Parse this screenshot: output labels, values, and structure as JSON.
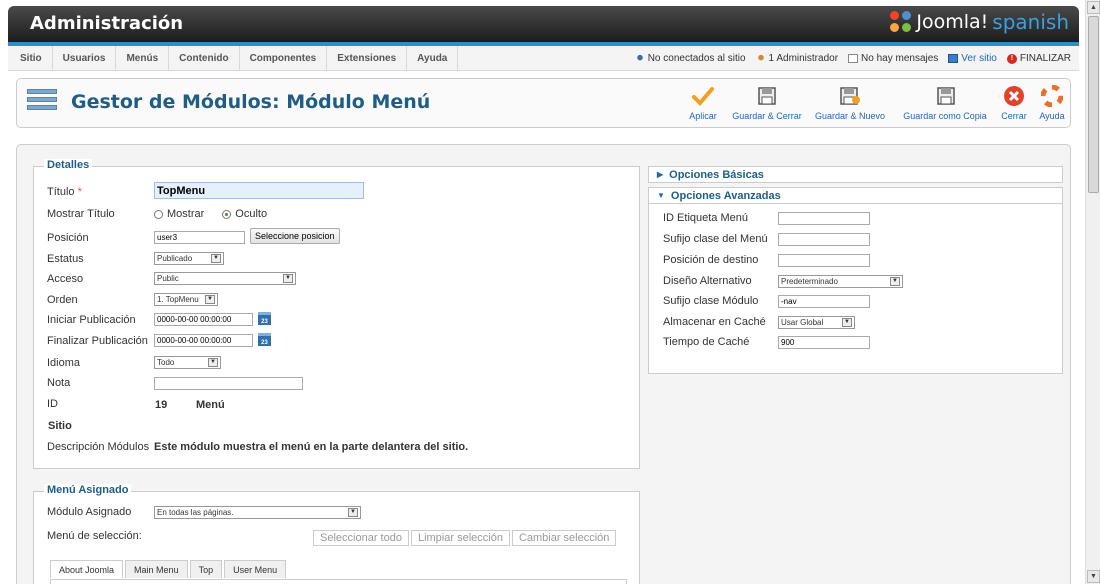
{
  "header": {
    "title": "Administración",
    "logo_main": "Joomla!",
    "logo_sub": "spanish"
  },
  "menu": [
    "Sitio",
    "Usuarios",
    "Menús",
    "Contenido",
    "Componentes",
    "Extensiones",
    "Ayuda"
  ],
  "status": {
    "visitors": "No conectados al sitio",
    "admins": "1 Administrador",
    "messages": "No hay mensajes",
    "view_site": "Ver sitio",
    "logout": "FINALIZAR"
  },
  "toolbar": {
    "page_title": "Gestor de Módulos: Módulo Menú",
    "buttons": [
      "Aplicar",
      "Guardar & Cerrar",
      "Guardar & Nuevo",
      "Guardar como Copia",
      "Cerrar",
      "Ayuda"
    ]
  },
  "details": {
    "legend": "Detalles",
    "titulo_label": "Título",
    "titulo_req": "*",
    "titulo_value": "TopMenu",
    "mostrar_label": "Mostrar Título",
    "mostrar_opt1": "Mostrar",
    "mostrar_opt2": "Oculto",
    "posicion_label": "Posición",
    "posicion_value": "user3",
    "posicion_button": "Seleccione posicion",
    "estatus_label": "Estatus",
    "estatus_value": "Publicado",
    "acceso_label": "Acceso",
    "acceso_value": "Public",
    "orden_label": "Orden",
    "orden_value": "1. TopMenu",
    "iniciar_label": "Iniciar Publicación",
    "iniciar_value": "0000-00-00 00:00:00",
    "finalizar_label": "Finalizar Publicación",
    "finalizar_value": "0000-00-00 00:00:00",
    "idioma_label": "Idioma",
    "idioma_value": "Todo",
    "nota_label": "Nota",
    "nota_value": "",
    "id_label": "ID",
    "id_value": "19",
    "id_type": "Menú",
    "sitio": "Sitio",
    "desc_label": "Descripción Módulos",
    "desc_value": "Este módulo muestra el menú en la parte delantera del sitio.",
    "cal_text": "23"
  },
  "options": {
    "basic": "Opciones Básicas",
    "advanced": "Opciones Avanzadas",
    "fields": [
      {
        "label": "ID Etiqueta Menú",
        "value": ""
      },
      {
        "label": "Sufijo clase del Menú",
        "value": ""
      },
      {
        "label": "Posición de destino",
        "value": ""
      },
      {
        "label": "Diseño Alternativo",
        "value": "Predeterminado"
      },
      {
        "label": "Sufijo clase Módulo",
        "value": "-nav"
      },
      {
        "label": "Almacenar en Caché",
        "value": "Usar Global"
      },
      {
        "label": "Tiempo de Caché",
        "value": "900"
      }
    ]
  },
  "assignment": {
    "legend": "Menú Asignado",
    "module_label": "Módulo Asignado",
    "module_value": "En todas las páginas.",
    "selection_label": "Menú de selección:",
    "buttons": [
      "Seleccionar todo",
      "Limpiar selección",
      "Cambiar selección"
    ],
    "tabs": [
      "About Joomla",
      "Main Menu",
      "Top",
      "User Menu"
    ]
  },
  "colors": {
    "accent": "#1f5d87",
    "link": "#2468b0",
    "header_stripe": "#2e8fc7"
  }
}
